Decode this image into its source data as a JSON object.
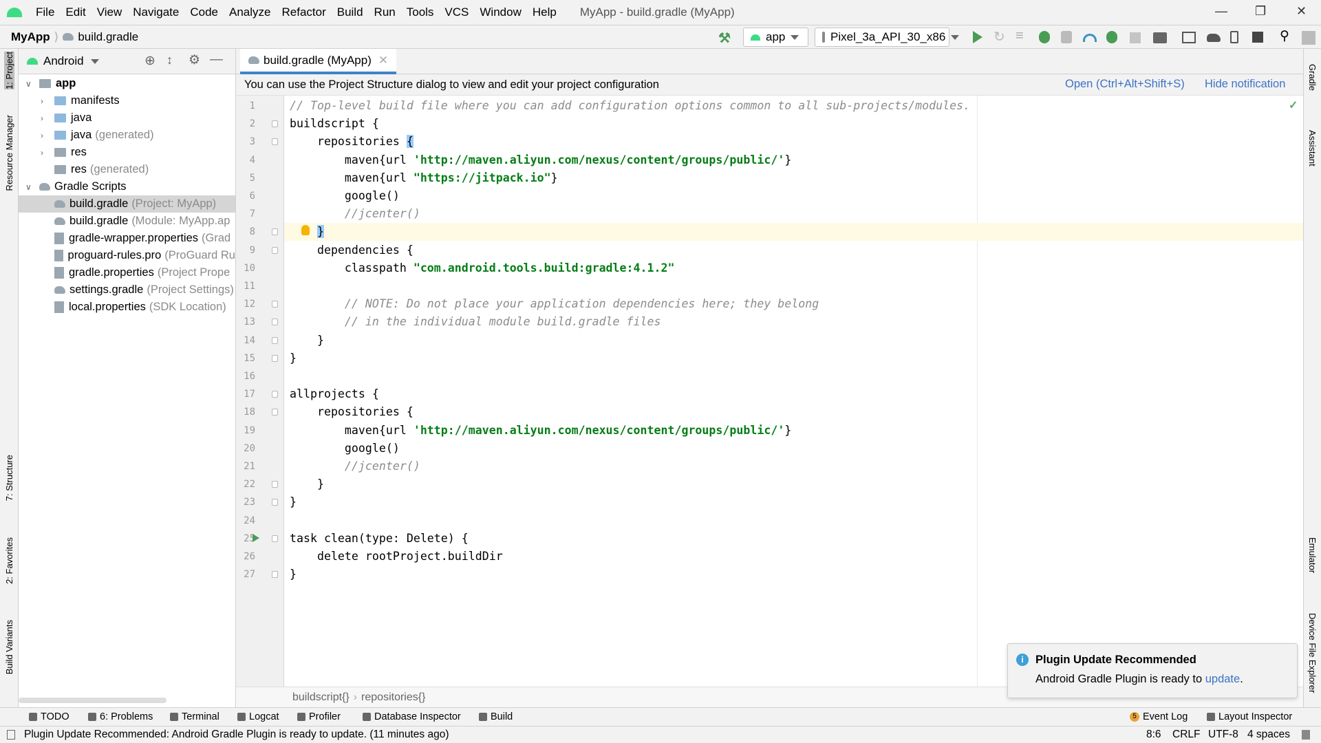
{
  "menu": [
    "File",
    "Edit",
    "View",
    "Navigate",
    "Code",
    "Analyze",
    "Refactor",
    "Build",
    "Run",
    "Tools",
    "VCS",
    "Window",
    "Help"
  ],
  "window_title": "MyApp - build.gradle (MyApp)",
  "nav": {
    "project": "MyApp",
    "file": "build.gradle",
    "run_config": "app",
    "device": "Pixel_3a_API_30_x86"
  },
  "toolbar_icons": [
    "hammer-icon",
    "run-icon",
    "apply-changes-icon",
    "apply-code-changes-icon",
    "debug-icon",
    "coverage-icon",
    "profile-icon",
    "attach-debugger-icon",
    "stop-icon",
    "project-structure-icon",
    "run-anything-icon",
    "sync-gradle-icon",
    "avd-manager-icon",
    "sdk-manager-icon",
    "search-icon",
    "user-icon"
  ],
  "left_stripe": [
    "1: Project",
    "Resource Manager",
    "7: Structure",
    "2: Favorites",
    "Build Variants"
  ],
  "right_stripe": [
    "Gradle",
    "Assistant",
    "Emulator",
    "Device File Explorer"
  ],
  "project": {
    "view": "Android",
    "tree": [
      {
        "label": "app",
        "hint": "",
        "level": 0,
        "icon": "module",
        "expanded": true,
        "bold": true
      },
      {
        "label": "manifests",
        "hint": "",
        "level": 1,
        "icon": "folder",
        "expanded": false
      },
      {
        "label": "java",
        "hint": "",
        "level": 1,
        "icon": "folder",
        "expanded": false
      },
      {
        "label": "java",
        "hint": "(generated)",
        "level": 1,
        "icon": "folder-gen",
        "expanded": false
      },
      {
        "label": "res",
        "hint": "",
        "level": 1,
        "icon": "folder-res",
        "expanded": false
      },
      {
        "label": "res",
        "hint": "(generated)",
        "level": 1,
        "icon": "folder-res",
        "leaf": true
      },
      {
        "label": "Gradle Scripts",
        "hint": "",
        "level": 0,
        "icon": "gradle",
        "expanded": true
      },
      {
        "label": "build.gradle",
        "hint": "(Project: MyApp)",
        "level": 1,
        "icon": "gradle",
        "leaf": true,
        "selected": true
      },
      {
        "label": "build.gradle",
        "hint": "(Module: MyApp.ap",
        "level": 1,
        "icon": "gradle",
        "leaf": true
      },
      {
        "label": "gradle-wrapper.properties",
        "hint": "(Grad",
        "level": 1,
        "icon": "properties",
        "leaf": true
      },
      {
        "label": "proguard-rules.pro",
        "hint": "(ProGuard Ru",
        "level": 1,
        "icon": "text",
        "leaf": true
      },
      {
        "label": "gradle.properties",
        "hint": "(Project Prope",
        "level": 1,
        "icon": "properties",
        "leaf": true
      },
      {
        "label": "settings.gradle",
        "hint": "(Project Settings)",
        "level": 1,
        "icon": "gradle",
        "leaf": true
      },
      {
        "label": "local.properties",
        "hint": "(SDK Location)",
        "level": 1,
        "icon": "properties",
        "leaf": true
      }
    ]
  },
  "tab": {
    "label": "build.gradle (MyApp)"
  },
  "banner": {
    "text": "You can use the Project Structure dialog to view and edit your project configuration",
    "open": "Open (Ctrl+Alt+Shift+S)",
    "hide": "Hide notification"
  },
  "editor": {
    "caret_line": 8,
    "lines": [
      [
        [
          "c",
          "// Top-level build file where you can add configuration options common to all sub-projects/modules."
        ]
      ],
      [
        [
          "p",
          "buildscript {"
        ]
      ],
      [
        [
          "p",
          "    repositories "
        ],
        [
          "b",
          "{"
        ]
      ],
      [
        [
          "p",
          "        maven{url "
        ],
        [
          "s",
          "'http://maven.aliyun.com/nexus/content/groups/public/'"
        ],
        [
          "p",
          "}"
        ]
      ],
      [
        [
          "p",
          "        maven{url "
        ],
        [
          "s",
          "\"https://jitpack.io\""
        ],
        [
          "p",
          "}"
        ]
      ],
      [
        [
          "p",
          "        google()"
        ]
      ],
      [
        [
          "c",
          "        //jcenter()"
        ]
      ],
      [
        [
          "p",
          "    "
        ],
        [
          "b",
          "}"
        ]
      ],
      [
        [
          "p",
          "    dependencies {"
        ]
      ],
      [
        [
          "p",
          "        classpath "
        ],
        [
          "s",
          "\"com.android.tools.build:gradle:4.1.2\""
        ]
      ],
      [],
      [
        [
          "c",
          "        // NOTE: Do not place your application dependencies here; they belong"
        ]
      ],
      [
        [
          "c",
          "        // in the individual module build.gradle files"
        ]
      ],
      [
        [
          "p",
          "    }"
        ]
      ],
      [
        [
          "p",
          "}"
        ]
      ],
      [],
      [
        [
          "p",
          "allprojects {"
        ]
      ],
      [
        [
          "p",
          "    repositories {"
        ]
      ],
      [
        [
          "p",
          "        maven{url "
        ],
        [
          "s",
          "'http://maven.aliyun.com/nexus/content/groups/public/'"
        ],
        [
          "p",
          "}"
        ]
      ],
      [
        [
          "p",
          "        google()"
        ]
      ],
      [
        [
          "c",
          "        //jcenter()"
        ]
      ],
      [
        [
          "p",
          "    }"
        ]
      ],
      [
        [
          "p",
          "}"
        ]
      ],
      [],
      [
        [
          "p",
          "task clean(type: Delete) {"
        ]
      ],
      [
        [
          "p",
          "    delete rootProject.buildDir"
        ]
      ],
      [
        [
          "p",
          "}"
        ]
      ]
    ],
    "fold_lines": [
      2,
      3,
      8,
      9,
      12,
      13,
      14,
      15,
      17,
      18,
      22,
      23,
      25,
      27
    ],
    "breadcrumbs": [
      "buildscript{}",
      "repositories{}"
    ]
  },
  "bottom_tools": [
    "TODO",
    "6: Problems",
    "Terminal",
    "Logcat",
    "Profiler",
    "Database Inspector",
    "Build"
  ],
  "bottom_tools_right": {
    "event_log": "Event Log",
    "event_count": "5",
    "layout_inspector": "Layout Inspector"
  },
  "popup": {
    "title": "Plugin Update Recommended",
    "text": "Android Gradle Plugin is ready to ",
    "link": "update",
    "end": "."
  },
  "status": {
    "message": "Plugin Update Recommended: Android Gradle Plugin is ready to update. (11 minutes ago)",
    "position": "8:6",
    "line_sep": "CRLF",
    "encoding": "UTF-8",
    "indent": "4 spaces"
  },
  "colors": {
    "accent": "#4083c9",
    "string": "#067d17",
    "comment": "#8c8c8c",
    "caret_line": "#fffae3",
    "android_green": "#3ddc84"
  }
}
